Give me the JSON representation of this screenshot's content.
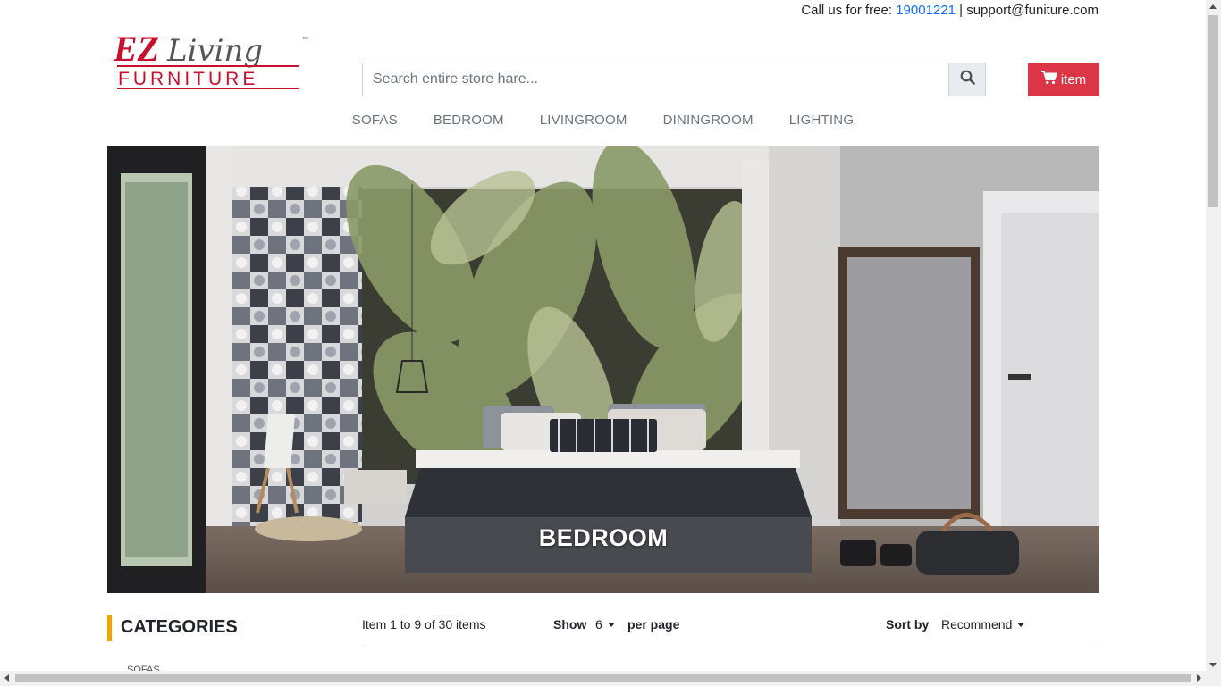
{
  "topbar": {
    "call_label": "Call us for free:",
    "phone": "19001221",
    "separator": "|",
    "email": "support@funiture.com"
  },
  "logo": {
    "brand_top": "EZ",
    "brand_script": "Living",
    "brand_bottom": "FURNITURE",
    "trademark": "™"
  },
  "search": {
    "placeholder": "Search entire store hare...",
    "value": "",
    "button_icon": "search-icon"
  },
  "cart": {
    "icon": "cart-icon",
    "label": "item",
    "color": "#dc3545"
  },
  "nav": {
    "items": [
      "SOFAS",
      "BEDROOM",
      "LIVINGROOM",
      "DININGROOM",
      "LIGHTING"
    ]
  },
  "hero": {
    "caption": "BEDROOM"
  },
  "sidebar": {
    "title": "CATEGORIES",
    "accent": "#f0a500",
    "first_item": "SOFAS"
  },
  "toolbar": {
    "count_text": "Item 1 to 9 of 30 items",
    "show_label": "Show",
    "show_value": "6",
    "per_page_label": "per page",
    "sort_label": "Sort by",
    "sort_value": "Recommend"
  }
}
